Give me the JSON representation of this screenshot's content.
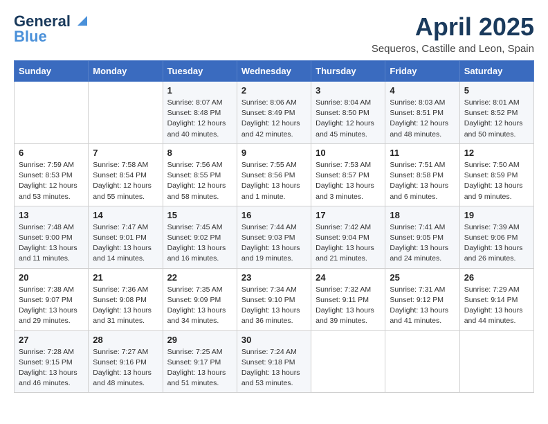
{
  "logo": {
    "general": "General",
    "blue": "Blue"
  },
  "header": {
    "month": "April 2025",
    "location": "Sequeros, Castille and Leon, Spain"
  },
  "weekdays": [
    "Sunday",
    "Monday",
    "Tuesday",
    "Wednesday",
    "Thursday",
    "Friday",
    "Saturday"
  ],
  "weeks": [
    [
      {
        "day": "",
        "sunrise": "",
        "sunset": "",
        "daylight": ""
      },
      {
        "day": "",
        "sunrise": "",
        "sunset": "",
        "daylight": ""
      },
      {
        "day": "1",
        "sunrise": "Sunrise: 8:07 AM",
        "sunset": "Sunset: 8:48 PM",
        "daylight": "Daylight: 12 hours and 40 minutes."
      },
      {
        "day": "2",
        "sunrise": "Sunrise: 8:06 AM",
        "sunset": "Sunset: 8:49 PM",
        "daylight": "Daylight: 12 hours and 42 minutes."
      },
      {
        "day": "3",
        "sunrise": "Sunrise: 8:04 AM",
        "sunset": "Sunset: 8:50 PM",
        "daylight": "Daylight: 12 hours and 45 minutes."
      },
      {
        "day": "4",
        "sunrise": "Sunrise: 8:03 AM",
        "sunset": "Sunset: 8:51 PM",
        "daylight": "Daylight: 12 hours and 48 minutes."
      },
      {
        "day": "5",
        "sunrise": "Sunrise: 8:01 AM",
        "sunset": "Sunset: 8:52 PM",
        "daylight": "Daylight: 12 hours and 50 minutes."
      }
    ],
    [
      {
        "day": "6",
        "sunrise": "Sunrise: 7:59 AM",
        "sunset": "Sunset: 8:53 PM",
        "daylight": "Daylight: 12 hours and 53 minutes."
      },
      {
        "day": "7",
        "sunrise": "Sunrise: 7:58 AM",
        "sunset": "Sunset: 8:54 PM",
        "daylight": "Daylight: 12 hours and 55 minutes."
      },
      {
        "day": "8",
        "sunrise": "Sunrise: 7:56 AM",
        "sunset": "Sunset: 8:55 PM",
        "daylight": "Daylight: 12 hours and 58 minutes."
      },
      {
        "day": "9",
        "sunrise": "Sunrise: 7:55 AM",
        "sunset": "Sunset: 8:56 PM",
        "daylight": "Daylight: 13 hours and 1 minute."
      },
      {
        "day": "10",
        "sunrise": "Sunrise: 7:53 AM",
        "sunset": "Sunset: 8:57 PM",
        "daylight": "Daylight: 13 hours and 3 minutes."
      },
      {
        "day": "11",
        "sunrise": "Sunrise: 7:51 AM",
        "sunset": "Sunset: 8:58 PM",
        "daylight": "Daylight: 13 hours and 6 minutes."
      },
      {
        "day": "12",
        "sunrise": "Sunrise: 7:50 AM",
        "sunset": "Sunset: 8:59 PM",
        "daylight": "Daylight: 13 hours and 9 minutes."
      }
    ],
    [
      {
        "day": "13",
        "sunrise": "Sunrise: 7:48 AM",
        "sunset": "Sunset: 9:00 PM",
        "daylight": "Daylight: 13 hours and 11 minutes."
      },
      {
        "day": "14",
        "sunrise": "Sunrise: 7:47 AM",
        "sunset": "Sunset: 9:01 PM",
        "daylight": "Daylight: 13 hours and 14 minutes."
      },
      {
        "day": "15",
        "sunrise": "Sunrise: 7:45 AM",
        "sunset": "Sunset: 9:02 PM",
        "daylight": "Daylight: 13 hours and 16 minutes."
      },
      {
        "day": "16",
        "sunrise": "Sunrise: 7:44 AM",
        "sunset": "Sunset: 9:03 PM",
        "daylight": "Daylight: 13 hours and 19 minutes."
      },
      {
        "day": "17",
        "sunrise": "Sunrise: 7:42 AM",
        "sunset": "Sunset: 9:04 PM",
        "daylight": "Daylight: 13 hours and 21 minutes."
      },
      {
        "day": "18",
        "sunrise": "Sunrise: 7:41 AM",
        "sunset": "Sunset: 9:05 PM",
        "daylight": "Daylight: 13 hours and 24 minutes."
      },
      {
        "day": "19",
        "sunrise": "Sunrise: 7:39 AM",
        "sunset": "Sunset: 9:06 PM",
        "daylight": "Daylight: 13 hours and 26 minutes."
      }
    ],
    [
      {
        "day": "20",
        "sunrise": "Sunrise: 7:38 AM",
        "sunset": "Sunset: 9:07 PM",
        "daylight": "Daylight: 13 hours and 29 minutes."
      },
      {
        "day": "21",
        "sunrise": "Sunrise: 7:36 AM",
        "sunset": "Sunset: 9:08 PM",
        "daylight": "Daylight: 13 hours and 31 minutes."
      },
      {
        "day": "22",
        "sunrise": "Sunrise: 7:35 AM",
        "sunset": "Sunset: 9:09 PM",
        "daylight": "Daylight: 13 hours and 34 minutes."
      },
      {
        "day": "23",
        "sunrise": "Sunrise: 7:34 AM",
        "sunset": "Sunset: 9:10 PM",
        "daylight": "Daylight: 13 hours and 36 minutes."
      },
      {
        "day": "24",
        "sunrise": "Sunrise: 7:32 AM",
        "sunset": "Sunset: 9:11 PM",
        "daylight": "Daylight: 13 hours and 39 minutes."
      },
      {
        "day": "25",
        "sunrise": "Sunrise: 7:31 AM",
        "sunset": "Sunset: 9:12 PM",
        "daylight": "Daylight: 13 hours and 41 minutes."
      },
      {
        "day": "26",
        "sunrise": "Sunrise: 7:29 AM",
        "sunset": "Sunset: 9:14 PM",
        "daylight": "Daylight: 13 hours and 44 minutes."
      }
    ],
    [
      {
        "day": "27",
        "sunrise": "Sunrise: 7:28 AM",
        "sunset": "Sunset: 9:15 PM",
        "daylight": "Daylight: 13 hours and 46 minutes."
      },
      {
        "day": "28",
        "sunrise": "Sunrise: 7:27 AM",
        "sunset": "Sunset: 9:16 PM",
        "daylight": "Daylight: 13 hours and 48 minutes."
      },
      {
        "day": "29",
        "sunrise": "Sunrise: 7:25 AM",
        "sunset": "Sunset: 9:17 PM",
        "daylight": "Daylight: 13 hours and 51 minutes."
      },
      {
        "day": "30",
        "sunrise": "Sunrise: 7:24 AM",
        "sunset": "Sunset: 9:18 PM",
        "daylight": "Daylight: 13 hours and 53 minutes."
      },
      {
        "day": "",
        "sunrise": "",
        "sunset": "",
        "daylight": ""
      },
      {
        "day": "",
        "sunrise": "",
        "sunset": "",
        "daylight": ""
      },
      {
        "day": "",
        "sunrise": "",
        "sunset": "",
        "daylight": ""
      }
    ]
  ]
}
